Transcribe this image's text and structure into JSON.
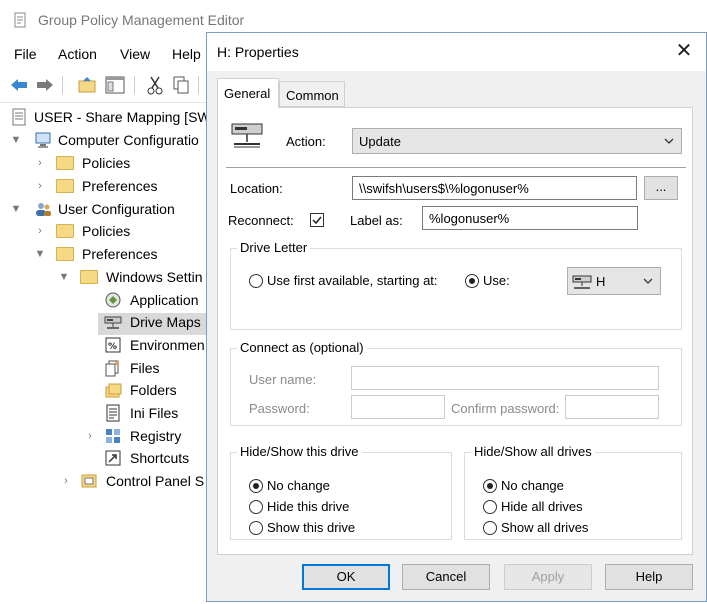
{
  "main_window": {
    "title": "Group Policy Management Editor",
    "menu": [
      "File",
      "Action",
      "View",
      "Help"
    ],
    "tree": [
      {
        "label": "USER - Share Mapping [SW",
        "icon": "policy-doc-icon"
      },
      {
        "label": "Computer Configuratio",
        "icon": "computer-icon"
      },
      {
        "label": "Policies",
        "icon": "folder-icon"
      },
      {
        "label": "Preferences",
        "icon": "folder-icon"
      },
      {
        "label": "User Configuration",
        "icon": "users-icon"
      },
      {
        "label": "Policies",
        "icon": "folder-icon"
      },
      {
        "label": "Preferences",
        "icon": "folder-icon"
      },
      {
        "label": "Windows Settin",
        "icon": "folder-icon"
      },
      {
        "label": "Application",
        "icon": "application-icon"
      },
      {
        "label": "Drive Maps",
        "icon": "drive-map-icon"
      },
      {
        "label": "Environmen",
        "icon": "environment-icon"
      },
      {
        "label": "Files",
        "icon": "files-icon"
      },
      {
        "label": "Folders",
        "icon": "folders-icon"
      },
      {
        "label": "Ini Files",
        "icon": "ini-files-icon"
      },
      {
        "label": "Registry",
        "icon": "registry-icon"
      },
      {
        "label": "Shortcuts",
        "icon": "shortcuts-icon"
      },
      {
        "label": "Control Panel S",
        "icon": "control-panel-icon"
      }
    ]
  },
  "dialog": {
    "title": "H: Properties",
    "close_glyph": "✕",
    "tabs": {
      "general": "General",
      "common": "Common"
    },
    "action_label": "Action:",
    "action_value": "Update",
    "location_label": "Location:",
    "location_value": "\\\\swifsh\\users$\\%logonuser%",
    "browse_label": "...",
    "reconnect_label": "Reconnect:",
    "reconnect_checked": true,
    "label_as_label": "Label as:",
    "label_as_value": "%logonuser%",
    "drive_letter": {
      "title": "Drive Letter",
      "first_available_label": "Use first available, starting at:",
      "use_label": "Use:",
      "selected": "use",
      "letter": "H"
    },
    "connect_as": {
      "title": "Connect as (optional)",
      "user_name_label": "User name:",
      "password_label": "Password:",
      "confirm_password_label": "Confirm password:"
    },
    "hide_show_drive": {
      "title": "Hide/Show this drive",
      "options": [
        "No change",
        "Hide this drive",
        "Show this drive"
      ],
      "selected": 0
    },
    "hide_show_all": {
      "title": "Hide/Show all drives",
      "options": [
        "No change",
        "Hide all drives",
        "Show all drives"
      ],
      "selected": 0
    },
    "buttons": {
      "ok": "OK",
      "cancel": "Cancel",
      "apply": "Apply",
      "help": "Help"
    },
    "accent_color": "#0078d7"
  }
}
